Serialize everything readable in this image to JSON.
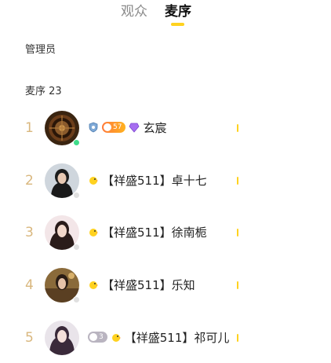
{
  "tabs": [
    {
      "label": "观众"
    },
    {
      "label": "麦序"
    }
  ],
  "sections": {
    "admin_title": "管理员",
    "queue_title": "麦序 23"
  },
  "colors": {
    "accent": "#ffd21f",
    "rank": "#d9b77e",
    "online": "#3fdc8a"
  },
  "queue": [
    {
      "rank": "1",
      "name": "玄宸",
      "level": "57",
      "icons": [
        "shield-icon",
        "level-badge",
        "gem-icon"
      ]
    },
    {
      "rank": "2",
      "name": "【祥盛511】卓十七",
      "icons": [
        "chick-icon"
      ]
    },
    {
      "rank": "3",
      "name": "【祥盛511】徐南栀",
      "icons": [
        "chick-icon"
      ]
    },
    {
      "rank": "4",
      "name": "【祥盛511】乐知",
      "icons": [
        "chick-icon"
      ]
    },
    {
      "rank": "5",
      "name": "【祥盛511】祁可儿",
      "level": "3",
      "icons": [
        "heart-badge",
        "chick-icon"
      ]
    }
  ]
}
